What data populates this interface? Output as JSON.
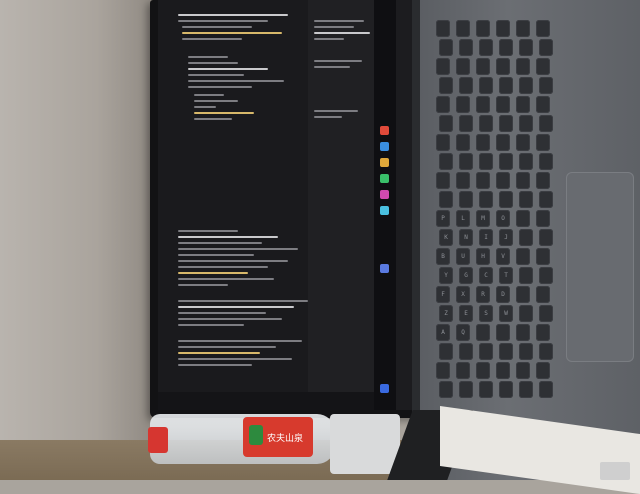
{
  "scene": {
    "type": "photo",
    "description": "Laptop photographed rotated 90 degrees showing a dark code editor, keyboard on the right, water bottle on desk",
    "colors": {
      "screen_bg": "#1c1c1f",
      "bottle_label": "#d73a2d",
      "keyboard_body": "#6b6e73"
    }
  },
  "bottle": {
    "label_text": "农夫山泉"
  },
  "keyboard": {
    "keys": [
      "P",
      "L",
      "M",
      "O",
      "K",
      "N",
      "I",
      "J",
      "B",
      "U",
      "H",
      "V",
      "Y",
      "G",
      "C",
      "T",
      "F",
      "X",
      "R",
      "D",
      "Z",
      "E",
      "S",
      "W",
      "A",
      "Q"
    ]
  },
  "screen": {
    "taskbar_icons": [
      "app-1",
      "app-2",
      "app-3",
      "app-4",
      "app-5",
      "app-6",
      "app-7",
      "app-8"
    ]
  }
}
